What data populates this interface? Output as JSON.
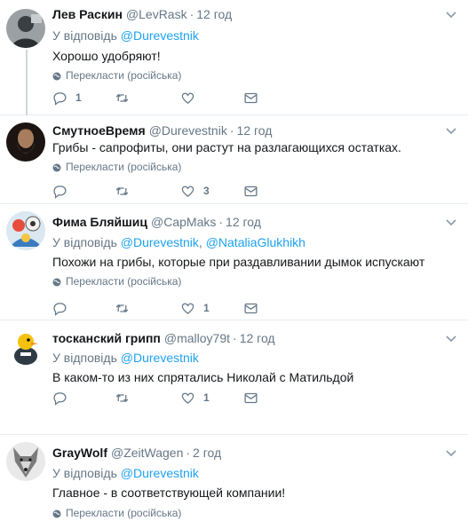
{
  "labels": {
    "reply_prefix": "У відповідь",
    "translate": "Перекласти (російська)"
  },
  "tweets": [
    {
      "name": "Лев Раскин",
      "handle": "@LevRask",
      "time": "12 год",
      "reply_mentions": [
        "@Durevestnik"
      ],
      "text": "Хорошо удобряют!",
      "reply_count": "1",
      "retweet_count": "",
      "like_count": "",
      "avatar_icon": "gray-photo-avatar"
    },
    {
      "name": "СмутноеВремя",
      "handle": "@Durevestnik",
      "time": "12 год",
      "reply_mentions": [],
      "text": "Грибы - сапрофиты, они растут на разлагающихся остатках.",
      "reply_count": "",
      "retweet_count": "",
      "like_count": "3",
      "avatar_icon": "bearded-man-avatar"
    },
    {
      "name": "Фима Бляйшиц",
      "handle": "@CapMaks",
      "time": "12 год",
      "reply_mentions": [
        "@Durevestnik",
        "@NataliaGlukhikh"
      ],
      "text": "Похожи на грибы, которые при раздавливании дымок испускают",
      "reply_count": "",
      "retweet_count": "",
      "like_count": "1",
      "avatar_icon": "cartoon-avatar"
    },
    {
      "name": "тосканский грипп",
      "handle": "@malloy79t",
      "time": "12 год",
      "reply_mentions": [
        "@Durevestnik"
      ],
      "text": "В каком-то из них спрятались Николай с Матильдой",
      "reply_count": "",
      "retweet_count": "",
      "like_count": "1",
      "avatar_icon": "duck-avatar"
    },
    {
      "name": "GrayWolf",
      "handle": "@ZeitWagen",
      "time": "2 год",
      "reply_mentions": [
        "@Durevestnik"
      ],
      "text": "Главное - в соответствующей компании!",
      "reply_count": "",
      "retweet_count": "",
      "like_count": "",
      "avatar_icon": "wolf-avatar"
    }
  ]
}
